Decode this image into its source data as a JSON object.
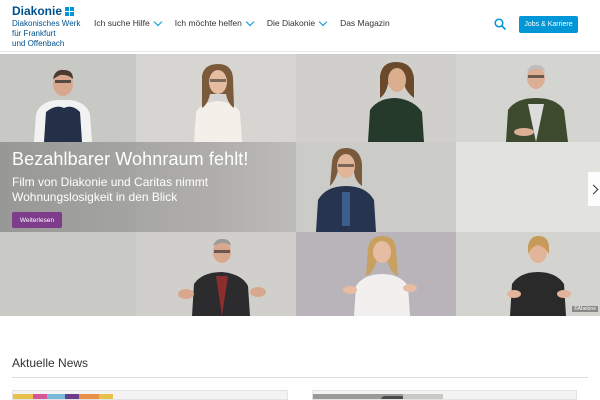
{
  "logo": {
    "brand": "Diakonie",
    "line1": "Diakonisches Werk",
    "line2": "für Frankfurt",
    "line3": "und Offenbach"
  },
  "nav": {
    "items": [
      {
        "label": "Ich suche Hilfe",
        "dropdown": true
      },
      {
        "label": "Ich möchte helfen",
        "dropdown": true
      },
      {
        "label": "Die Diakonie",
        "dropdown": true
      },
      {
        "label": "Das Magazin",
        "dropdown": false
      }
    ],
    "search_icon": "search-icon",
    "jobs_button": "Jobs & Karriere"
  },
  "hero": {
    "title": "Bezahlbarer Wohnraum fehlt!",
    "subtitle": "Film von Diakonie und Caritas nimmt Wohnungslosigkeit in den Blick",
    "button": "Weiterlesen",
    "credit": "©Abelone",
    "arrow_icon": "chevron-right-icon"
  },
  "news": {
    "heading": "Aktuelle News"
  },
  "colors": {
    "brand_blue": "#0096d7",
    "logo_navy": "#00508c",
    "button_purple": "#7d3c8c"
  }
}
